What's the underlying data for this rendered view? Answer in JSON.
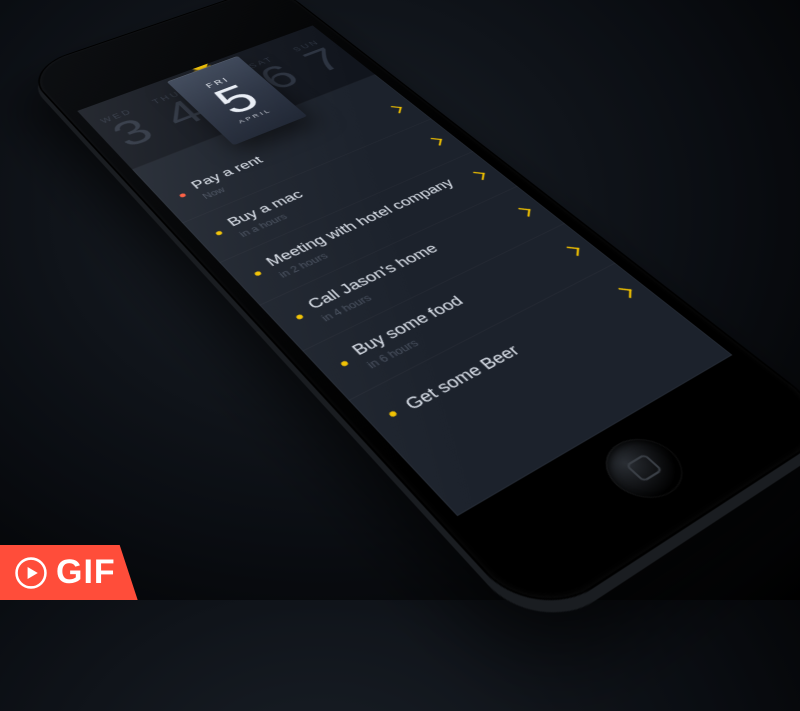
{
  "calendar": {
    "month": "APRIL",
    "days": [
      {
        "dow": "WED",
        "num": "3"
      },
      {
        "dow": "THU",
        "num": "4"
      },
      {
        "dow": "FRI",
        "num": "5"
      },
      {
        "dow": "SAT",
        "num": "6"
      },
      {
        "dow": "SUN",
        "num": "7"
      }
    ],
    "selected_index": 2
  },
  "tasks": [
    {
      "title": "Pay a rent",
      "sub": "Now",
      "dot": "red"
    },
    {
      "title": "Buy a mac",
      "sub": "in a hours",
      "dot": "yel"
    },
    {
      "title": "Meeting with hotel company",
      "sub": "in 2 hours",
      "dot": "yel"
    },
    {
      "title": "Call Jason's home",
      "sub": "in 4 hours",
      "dot": "yel"
    },
    {
      "title": "Buy some food",
      "sub": "in 6 hours",
      "dot": "yel"
    },
    {
      "title": "Get some Beer",
      "sub": "",
      "dot": "yel"
    }
  ],
  "badge": {
    "label": "GIF"
  },
  "colors": {
    "accent": "#f2c200",
    "bg": "#1c222c",
    "danger": "#ff5a3c"
  }
}
